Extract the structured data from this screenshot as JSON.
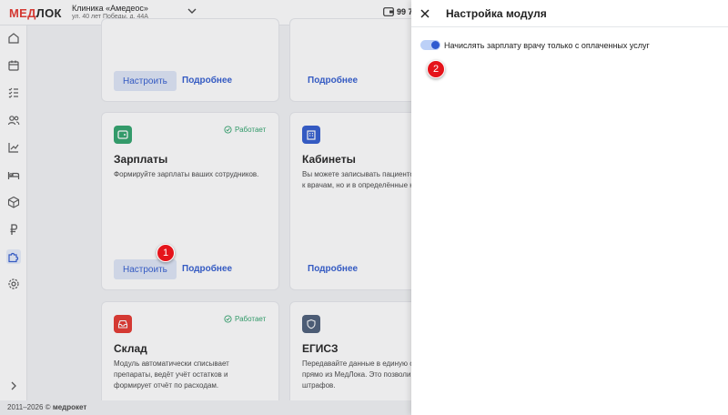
{
  "header": {
    "logo_prefix": "МЕД",
    "logo_suffix": "ЛОК",
    "clinic_name": "Клиника «Амедеос»",
    "clinic_address": "ул. 40 лет Победы, д. 44А",
    "phone_partial": "99 7"
  },
  "sidebar": {
    "items": [
      {
        "icon": "home-icon"
      },
      {
        "icon": "calendar-icon"
      },
      {
        "icon": "checklist-icon"
      },
      {
        "icon": "users-icon"
      },
      {
        "icon": "chart-icon"
      },
      {
        "icon": "bed-icon"
      },
      {
        "icon": "box-icon"
      },
      {
        "icon": "ruble-icon"
      },
      {
        "icon": "puzzle-icon"
      },
      {
        "icon": "gear-icon"
      }
    ]
  },
  "cards": {
    "top_left": {
      "configure": "Настроить",
      "more": "Подробнее"
    },
    "top_right": {
      "more": "Подробнее"
    },
    "salaries": {
      "title": "Зарплаты",
      "description": "Формируйте зарплаты ваших сотрудников.",
      "status": "Работает",
      "configure": "Настроить",
      "more": "Подробнее"
    },
    "rooms": {
      "title": "Кабинеты",
      "description_line1": "Вы можете записывать пациенто",
      "description_line2": "к врачам, но и в определённые к",
      "more": "Подробнее"
    },
    "warehouse": {
      "title": "Склад",
      "status": "Работает",
      "description_line1": "Модуль автоматически списывает",
      "description_line2": "препараты, ведёт учёт остатков и",
      "description_line3": "формирует отчёт по расходам."
    },
    "egisz": {
      "title": "ЕГИСЗ",
      "description_line1": "Передавайте данные в единую с",
      "description_line2": "прямо из МедЛока. Это позволи",
      "description_line3": "штрафов."
    }
  },
  "markers": {
    "one": "1",
    "two": "2"
  },
  "footer": {
    "years": "2011–2026 ©",
    "brand": "медрокет"
  },
  "panel": {
    "title": "Настройка модуля",
    "toggle_label": "Начислять зарплату врачу только с оплаченных услуг"
  },
  "colors": {
    "accent": "#2f5bd0",
    "brand_red": "#e5352d",
    "success": "#2ea36b",
    "salary_icon": "#2ea36b",
    "rooms_icon": "#2f5bd0",
    "warehouse_icon": "#e5352d",
    "egisz_icon": "#4a5d78"
  }
}
